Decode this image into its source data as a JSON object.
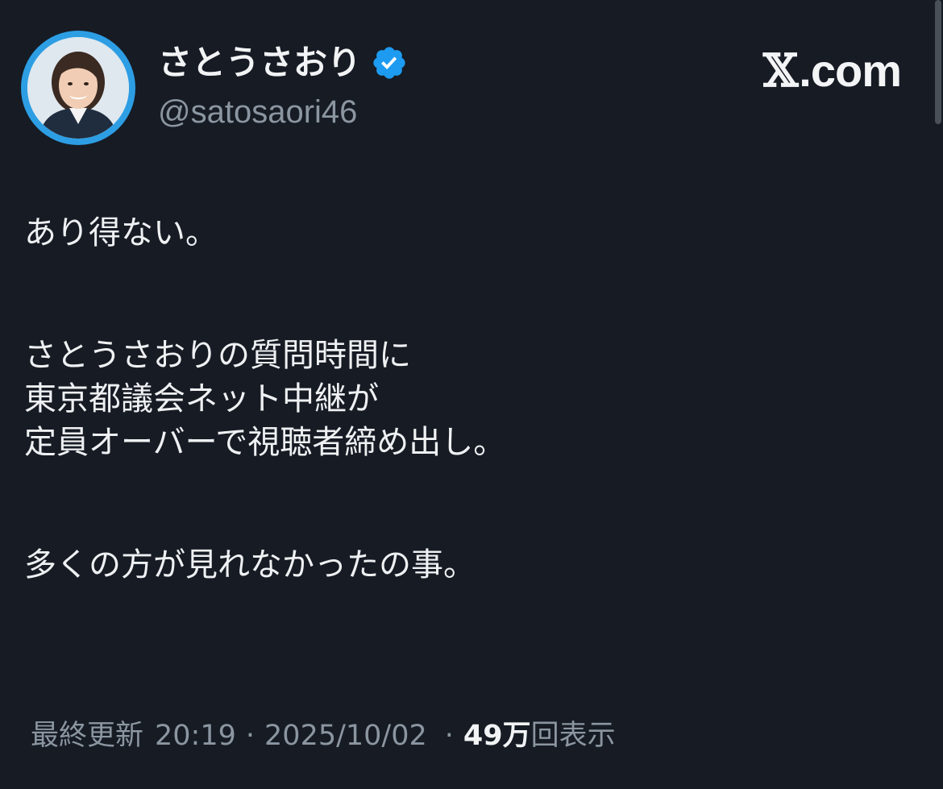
{
  "author": {
    "display_name": "さとうさおり",
    "handle": "@satosaori46",
    "verified": true
  },
  "brand": {
    "x_symbol": "𝕏",
    "domain": ".com"
  },
  "tweet": {
    "paragraphs": [
      [
        "あり得ない。"
      ],
      [
        "さとうさおりの質問時間に",
        "東京都議会ネット中継が",
        "定員オーバーで視聴者締め出し。"
      ],
      [
        "多くの方が見れなかったの事。"
      ]
    ]
  },
  "meta": {
    "last_updated_label": "最終更新",
    "time": "20:19",
    "separator": "·",
    "date": "2025/10/02",
    "views_count": "49万",
    "views_label": "回表示"
  },
  "colors": {
    "background": "#161b24",
    "verified_blue": "#1d9bf0",
    "avatar_ring": "#2d9ee4",
    "muted_text": "#8b96a1"
  },
  "icons": {
    "verified": "verified-badge-icon",
    "avatar": "profile-photo"
  }
}
